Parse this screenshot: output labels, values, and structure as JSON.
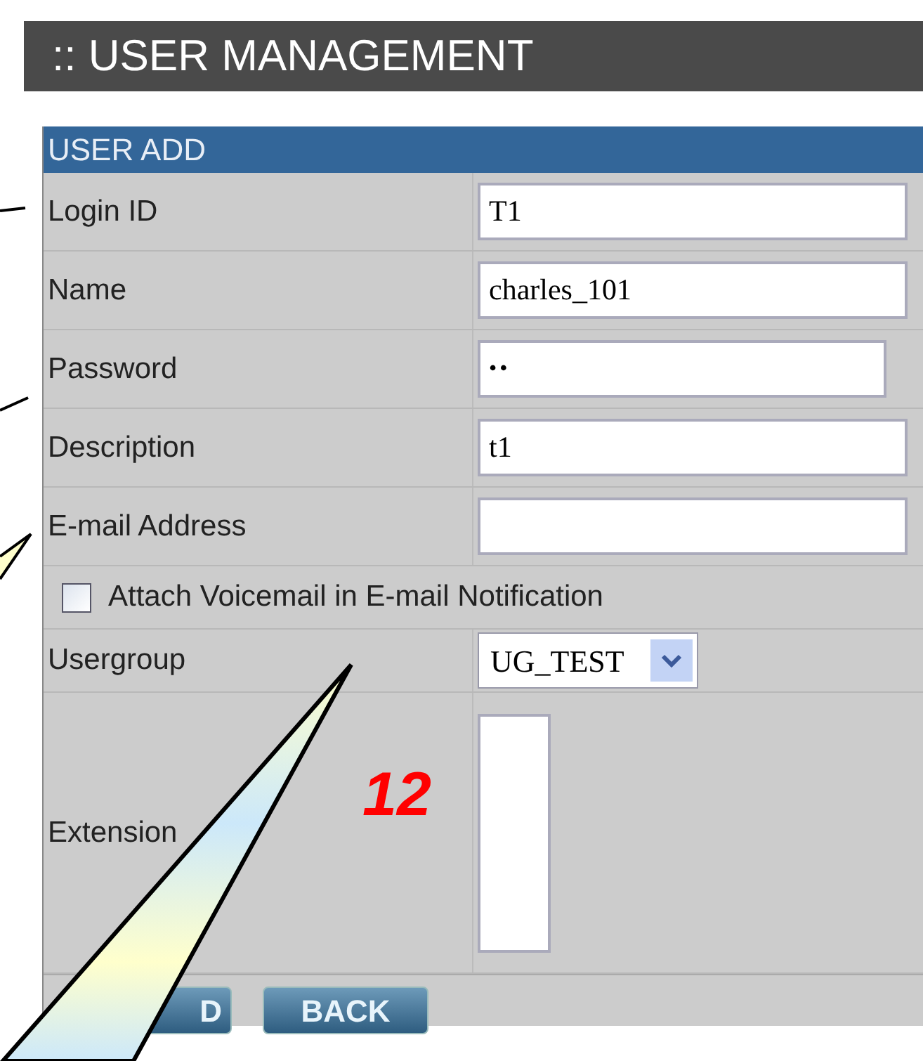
{
  "page_title": ":: USER MANAGEMENT",
  "panel": {
    "title": "USER ADD",
    "rows": [
      {
        "kind": "text",
        "label": "Login ID",
        "value": "T1"
      },
      {
        "kind": "text",
        "label": "Name",
        "value": "charles_101"
      },
      {
        "kind": "password",
        "label": "Password",
        "value": "••"
      },
      {
        "kind": "text",
        "label": "Description",
        "value": "t1"
      },
      {
        "kind": "text",
        "label": "E-mail Address"
      },
      {
        "kind": "checkbox",
        "label": "Attach Voicemail in E-mail Notification",
        "checked": false
      },
      {
        "kind": "select",
        "label": "Usergroup",
        "value": "UG_TEST"
      },
      {
        "kind": "listbox",
        "label": "Extension"
      }
    ],
    "buttons": [
      "D",
      "BACK"
    ]
  },
  "callout_number": "12"
}
